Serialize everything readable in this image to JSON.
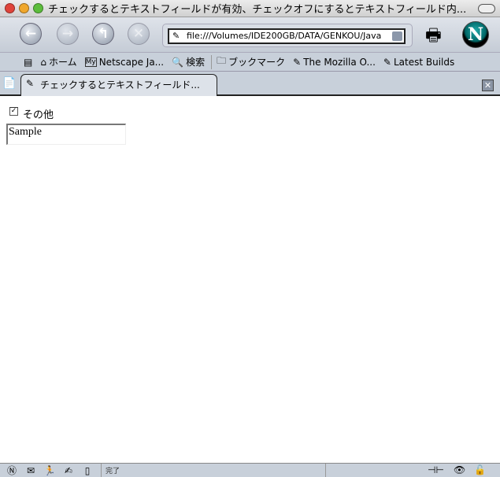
{
  "window": {
    "title": "チェックするとテキストフィールドが有効、チェックオフにするとテキストフィールド内..."
  },
  "nav": {
    "url": "file:///Volumes/IDE200GB/DATA/GENKOU/Java"
  },
  "bookmarks": [
    "ホーム",
    "Netscape Ja...",
    "検索",
    "ブックマーク",
    "The Mozilla O...",
    "Latest Builds"
  ],
  "tab": {
    "label": "チェックするとテキストフィールド..."
  },
  "content": {
    "checkbox_label": "その他",
    "checkbox_checked": true,
    "textfield_value": "Sample"
  },
  "status": {
    "text": "完了"
  }
}
